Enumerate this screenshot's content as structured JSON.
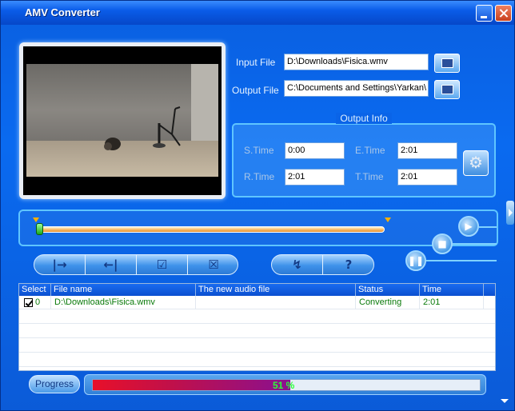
{
  "window": {
    "title": "AMV Converter"
  },
  "io": {
    "input_label": "Input File",
    "input_value": "D:\\Downloads\\Fisica.wmv",
    "output_label": "Output File",
    "output_value": "C:\\Documents and Settings\\Yarkan\\"
  },
  "output_info": {
    "title": "Output Info",
    "s_time_label": "S.Time",
    "s_time": "0:00",
    "e_time_label": "E.Time",
    "e_time": "2:01",
    "r_time_label": "R.Time",
    "r_time": "2:01",
    "t_time_label": "T.Time",
    "t_time": "2:01"
  },
  "controls": {
    "set_start": "|→",
    "set_end": "←|",
    "check": "☑",
    "remove": "☒",
    "convert": "↯",
    "help": "?"
  },
  "table": {
    "headers": [
      "Select",
      "File name",
      "The new audio file",
      "Status",
      "Time"
    ],
    "rows": [
      {
        "index": "0",
        "file_name": "D:\\Downloads\\Fisica.wmv",
        "audio_file": "",
        "status": "Converting",
        "time": "2:01"
      }
    ]
  },
  "progress": {
    "label": "Progress",
    "percent_value": 51,
    "percent_text": "51 %"
  },
  "colors": {
    "accent": "#0a5fe0",
    "progress_fill": "#c0104a",
    "status_text": "#0a7a0a"
  }
}
